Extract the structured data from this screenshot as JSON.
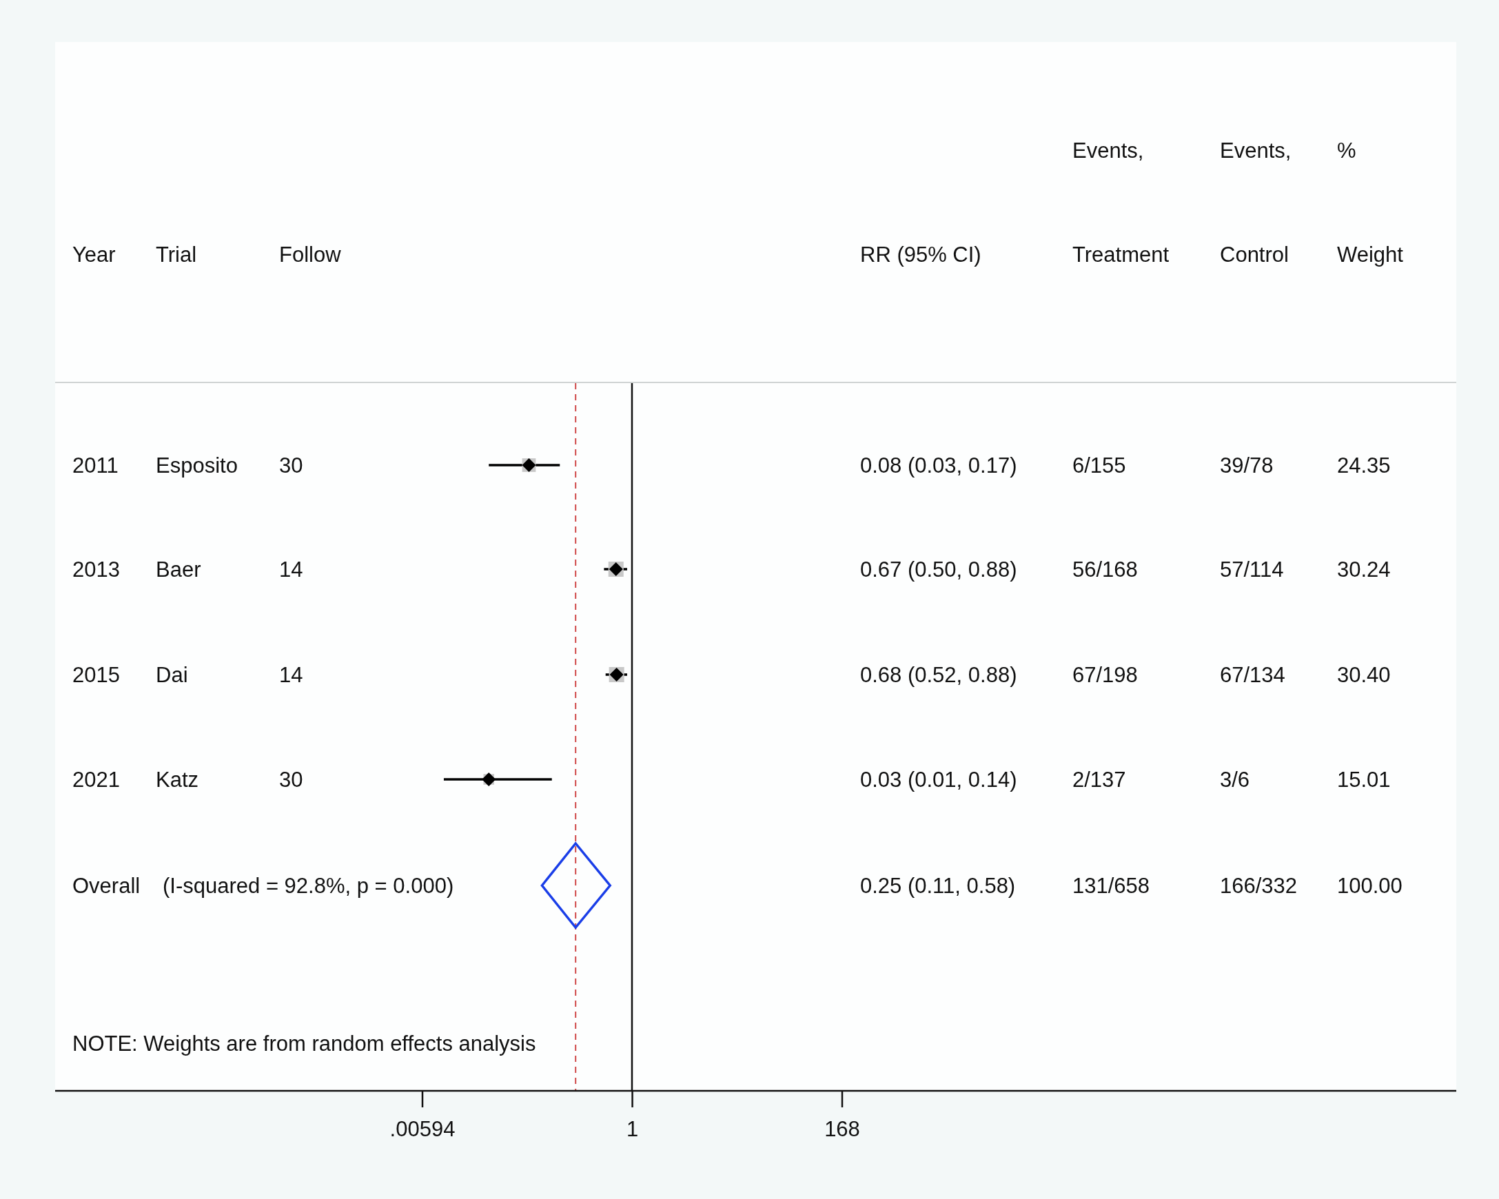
{
  "header": {
    "columns": [
      {
        "label": "Year"
      },
      {
        "label": "Trial"
      },
      {
        "label": "Follow"
      },
      {
        "label": "RR (95% CI)"
      },
      {
        "top": "Events,",
        "label": "Treatment"
      },
      {
        "top": "Events,",
        "label": "Control"
      },
      {
        "top": "%",
        "label": "Weight"
      }
    ]
  },
  "rows": [
    {
      "year": "2011",
      "trial": "Esposito",
      "follow": "30",
      "rr": "0.08 (0.03, 0.17)",
      "treatment": "6/155",
      "control": "39/78",
      "weight": "24.35"
    },
    {
      "year": "2013",
      "trial": "Baer",
      "follow": "14",
      "rr": "0.67 (0.50, 0.88)",
      "treatment": "56/168",
      "control": "57/114",
      "weight": "30.24"
    },
    {
      "year": "2015",
      "trial": "Dai",
      "follow": "14",
      "rr": "0.68 (0.52, 0.88)",
      "treatment": "67/198",
      "control": "67/134",
      "weight": "30.40"
    },
    {
      "year": "2021",
      "trial": "Katz",
      "follow": "30",
      "rr": "0.03 (0.01, 0.14)",
      "treatment": "2/137",
      "control": "3/6",
      "weight": "15.01"
    }
  ],
  "overall": {
    "label": "Overall",
    "heterogeneity": "(I-squared = 92.8%, p = 0.000)",
    "rr": "0.25 (0.11, 0.58)",
    "treatment": "131/658",
    "control": "166/332",
    "weight": "100.00"
  },
  "note": "NOTE: Weights are from random effects analysis",
  "x_axis": {
    "ticks": [
      ".00594",
      "1",
      "168"
    ]
  }
}
